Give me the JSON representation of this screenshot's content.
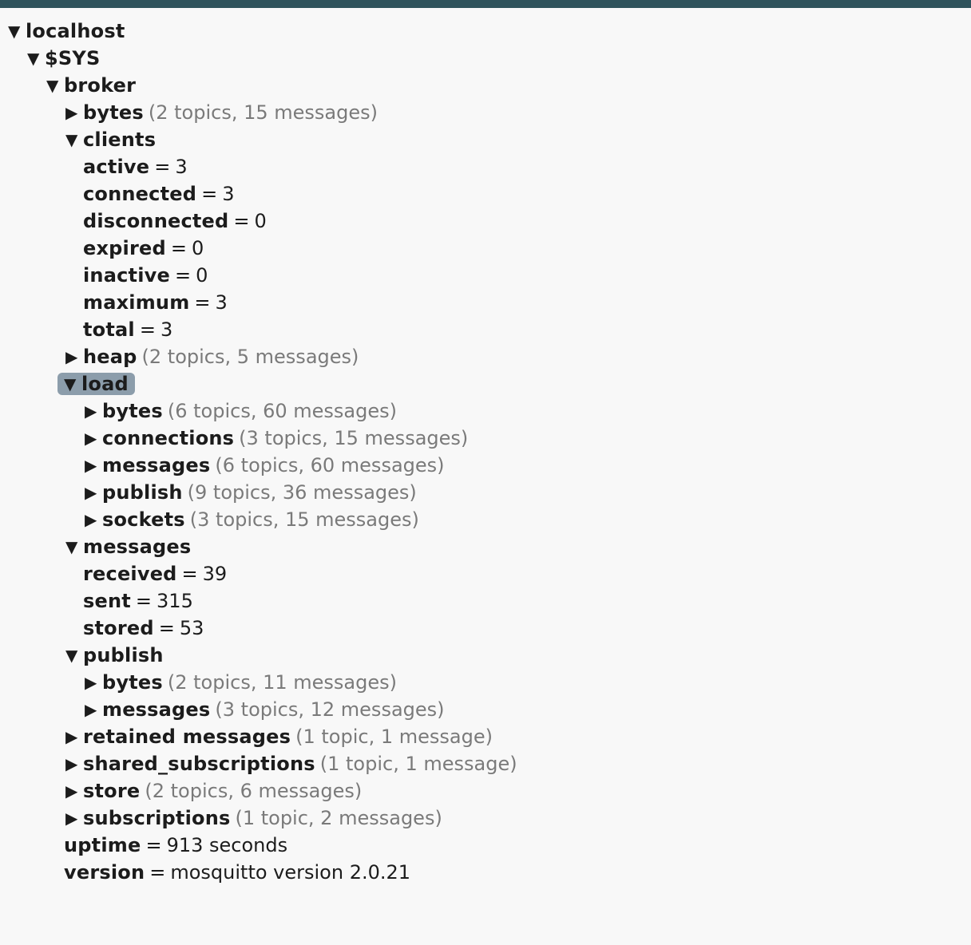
{
  "tree": {
    "localhost": {
      "toggle": "▼",
      "name": "localhost"
    },
    "sys": {
      "toggle": "▼",
      "name": "$SYS"
    },
    "broker": {
      "toggle": "▼",
      "name": "broker"
    },
    "bytes": {
      "toggle": "▶",
      "name": "bytes",
      "summary": "(2 topics, 15 messages)"
    },
    "clients": {
      "toggle": "▼",
      "name": "clients",
      "items": [
        {
          "name": "active",
          "eq": "=",
          "value": "3"
        },
        {
          "name": "connected",
          "eq": "=",
          "value": "3"
        },
        {
          "name": "disconnected",
          "eq": "=",
          "value": "0"
        },
        {
          "name": "expired",
          "eq": "=",
          "value": "0"
        },
        {
          "name": "inactive",
          "eq": "=",
          "value": "0"
        },
        {
          "name": "maximum",
          "eq": "=",
          "value": "3"
        },
        {
          "name": "total",
          "eq": "=",
          "value": "3"
        }
      ]
    },
    "heap": {
      "toggle": "▶",
      "name": "heap",
      "summary": "(2 topics, 5 messages)"
    },
    "load": {
      "toggle": "▼",
      "name": "load",
      "selected": true,
      "items": [
        {
          "toggle": "▶",
          "name": "bytes",
          "summary": "(6 topics, 60 messages)"
        },
        {
          "toggle": "▶",
          "name": "connections",
          "summary": "(3 topics, 15 messages)"
        },
        {
          "toggle": "▶",
          "name": "messages",
          "summary": "(6 topics, 60 messages)"
        },
        {
          "toggle": "▶",
          "name": "publish",
          "summary": "(9 topics, 36 messages)"
        },
        {
          "toggle": "▶",
          "name": "sockets",
          "summary": "(3 topics, 15 messages)"
        }
      ]
    },
    "messages": {
      "toggle": "▼",
      "name": "messages",
      "items": [
        {
          "name": "received",
          "eq": "=",
          "value": "39"
        },
        {
          "name": "sent",
          "eq": "=",
          "value": "315"
        },
        {
          "name": "stored",
          "eq": "=",
          "value": "53"
        }
      ]
    },
    "publish": {
      "toggle": "▼",
      "name": "publish",
      "items": [
        {
          "toggle": "▶",
          "name": "bytes",
          "summary": "(2 topics, 11 messages)"
        },
        {
          "toggle": "▶",
          "name": "messages",
          "summary": "(3 topics, 12 messages)"
        }
      ]
    },
    "retained": {
      "toggle": "▶",
      "name": "retained messages",
      "summary": "(1 topic, 1 message)"
    },
    "shared": {
      "toggle": "▶",
      "name": "shared_subscriptions",
      "summary": "(1 topic, 1 message)"
    },
    "store": {
      "toggle": "▶",
      "name": "store",
      "summary": "(2 topics, 6 messages)"
    },
    "subscriptions": {
      "toggle": "▶",
      "name": "subscriptions",
      "summary": "(1 topic, 2 messages)"
    },
    "uptime": {
      "name": "uptime",
      "eq": "=",
      "value": "913 seconds"
    },
    "version": {
      "name": "version",
      "eq": "=",
      "value": "mosquitto version 2.0.21"
    }
  },
  "colors": {
    "title_bar": "#2f535c",
    "background": "#f8f8f8",
    "selection": "#8c9dab",
    "summary_text": "#7a7a7a"
  }
}
